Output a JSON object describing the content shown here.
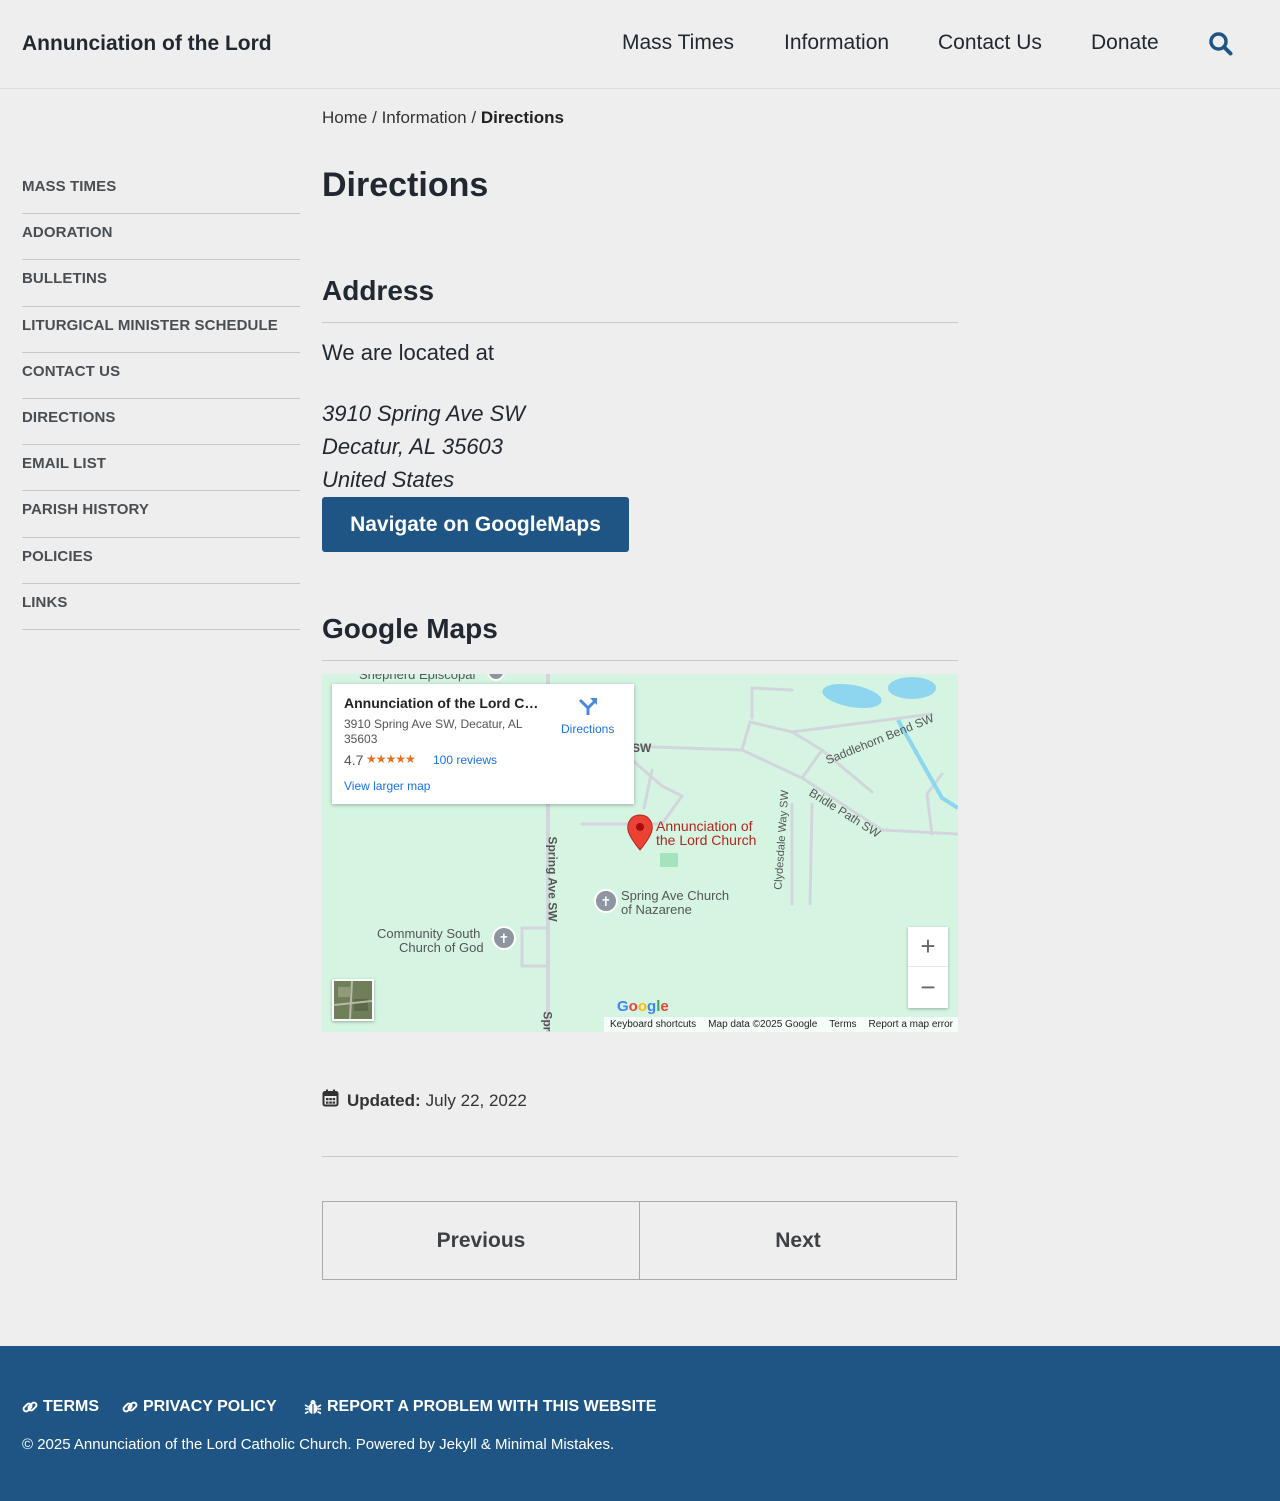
{
  "header": {
    "site_title": "Annunciation of the Lord",
    "nav": [
      "Mass Times",
      "Information",
      "Contact Us",
      "Donate"
    ]
  },
  "breadcrumb": {
    "home": "Home",
    "sep": "/",
    "section": "Information",
    "current": "Directions"
  },
  "sidebar": {
    "items": [
      "MASS TIMES",
      "ADORATION",
      "BULLETINS",
      "LITURGICAL MINISTER SCHEDULE",
      "CONTACT US",
      "DIRECTIONS",
      "EMAIL LIST",
      "PARISH HISTORY",
      "POLICIES",
      "LINKS"
    ]
  },
  "main": {
    "title": "Directions",
    "address_heading": "Address",
    "intro": "We are located at",
    "address_lines": [
      "3910 Spring Ave SW",
      "Decatur, AL 35603",
      "United States"
    ],
    "navigate_button": "Navigate on GoogleMaps",
    "maps_heading": "Google Maps"
  },
  "map": {
    "card_title": "Annunciation of the Lord Church",
    "card_address": "3910 Spring Ave SW, Decatur, AL 35603",
    "rating": "4.7",
    "stars": "★★★★★",
    "reviews": "100 reviews",
    "view_larger": "View larger map",
    "directions": "Directions",
    "pin_label_1": "Annunciation of",
    "pin_label_2": "the Lord Church",
    "poi_1_line1": "Spring Ave Church",
    "poi_1_line2": "of Nazarene",
    "poi_2_line1": "Community South",
    "poi_2_line2": "Church of God",
    "poi_3": "Shepherd Episcopal",
    "street_spring": "Spring Ave SW",
    "street_spring_short": "Spri",
    "street_sw": "SW",
    "street_saddlehorn": "Saddlehorn Bend SW",
    "street_bridle": "Bridle Path SW",
    "street_clydesdale": "Clydesdale Way SW",
    "google": "Google",
    "zoom_in": "+",
    "zoom_out": "−",
    "footer": [
      "Keyboard shortcuts",
      "Map data ©2025 Google",
      "Terms",
      "Report a map error"
    ],
    "colors": {
      "land": "#d5f5e2",
      "water": "#8ed5f0",
      "road": "#d2d6dc",
      "pin": "#ea4335"
    }
  },
  "updated": {
    "label": "Updated:",
    "date": "July 22, 2022"
  },
  "pager": {
    "previous": "Previous",
    "next": "Next"
  },
  "footer": {
    "links": [
      "TERMS",
      "PRIVACY POLICY",
      "REPORT A PROBLEM WITH THIS WEBSITE"
    ],
    "copyright": "© 2025 Annunciation of the Lord Catholic Church. Powered by Jekyll & Minimal Mistakes."
  },
  "colors": {
    "accent": "#1e5585",
    "background": "#eeeeee",
    "heading": "#222831"
  }
}
